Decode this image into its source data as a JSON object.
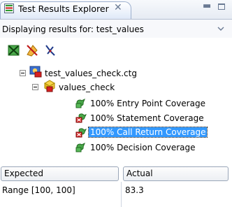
{
  "view": {
    "tab_title": "Test Results Explorer",
    "displaying_label": "Displaying results for: test_values"
  },
  "toolbar": {
    "buttons": [
      "filter-passed-icon",
      "filter-failed-icon",
      "collapse-icon"
    ]
  },
  "tree": {
    "root": {
      "label": "test_values_check.ctg",
      "icon": "testcase-group-icon"
    },
    "group": {
      "label": "values_check",
      "icon": "package-failed-icon"
    },
    "items": [
      {
        "label": "100% Entry Point Coverage",
        "status": "passed",
        "selected": false
      },
      {
        "label": "100% Statement Coverage",
        "status": "failed",
        "selected": false
      },
      {
        "label": "100% Call Return Coverage",
        "status": "failed",
        "selected": true
      },
      {
        "label": "100% Decision Coverage",
        "status": "passed",
        "selected": false
      }
    ]
  },
  "table": {
    "headers": [
      "Expected",
      "Actual"
    ],
    "rows": [
      [
        "Range [100, 100]",
        "83.3"
      ]
    ]
  },
  "colors": {
    "selection": "#3399ff",
    "passed": "#2e9b2e",
    "failed": "#d01818",
    "header_border": "#9aa6b8"
  }
}
